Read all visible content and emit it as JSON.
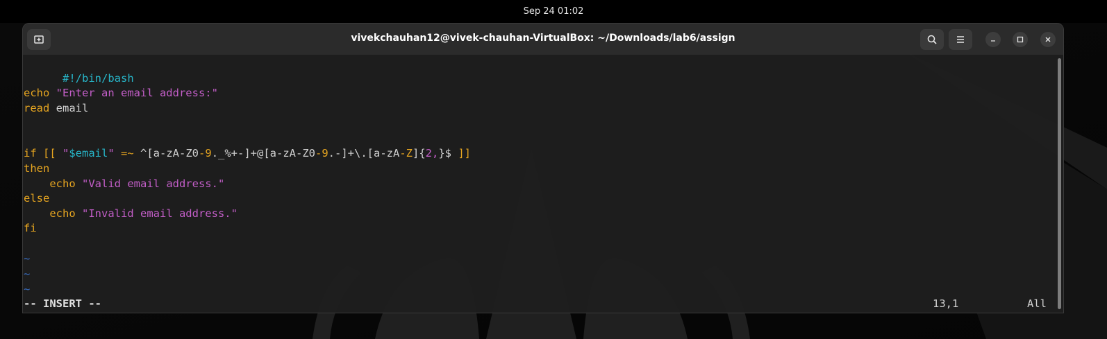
{
  "topbar": {
    "datetime": "Sep 24  01:02"
  },
  "window": {
    "title": "vivekchauhan12@vivek-chauhan-VirtualBox: ~/Downloads/lab6/assign",
    "buttons": {
      "new_tab_icon": "new-tab-icon",
      "search_icon": "search-icon",
      "menu_icon": "hamburger-menu-icon",
      "minimize_icon": "minimize-icon",
      "maximize_icon": "maximize-icon",
      "close_icon": "close-icon"
    }
  },
  "editor": {
    "lines": {
      "shebang": "#!/bin/bash",
      "echo1_cmd": "echo",
      "echo1_str": "\"Enter an email address:\"",
      "read_cmd": "read",
      "read_arg": " email",
      "if_kw": "if",
      "if_open": " [[ ",
      "if_q1": "\"",
      "if_var": "$email",
      "if_q2": "\"",
      "if_op": " =~ ",
      "re_1": "^[a-zA-Z0",
      "re_2": "-9",
      "re_3": "._%+-]+@[a-zA-Z0",
      "re_4": "-9",
      "re_5": ".-]+\\.[a-zA",
      "re_6": "-Z",
      "re_7": "]{",
      "re_8": "2,",
      "re_9": "}$",
      "if_close": " ]]",
      "then_kw": "then",
      "echo2_indent": "    ",
      "echo2_cmd": "echo",
      "echo2_str": "\"Valid email address.\"",
      "else_kw": "else",
      "echo3_indent": "    ",
      "echo3_cmd": "echo",
      "echo3_str": "\"Invalid email address.\"",
      "fi_kw": "fi",
      "tilde": "~"
    },
    "status": {
      "mode": "-- INSERT --",
      "position": "13,1",
      "scroll": "All"
    }
  },
  "colors": {
    "keyword": "#e6a520",
    "string": "#c35ec8",
    "shebang": "#27b6c9",
    "tilde": "#3a6fc4",
    "background": "#1e1e1e"
  }
}
